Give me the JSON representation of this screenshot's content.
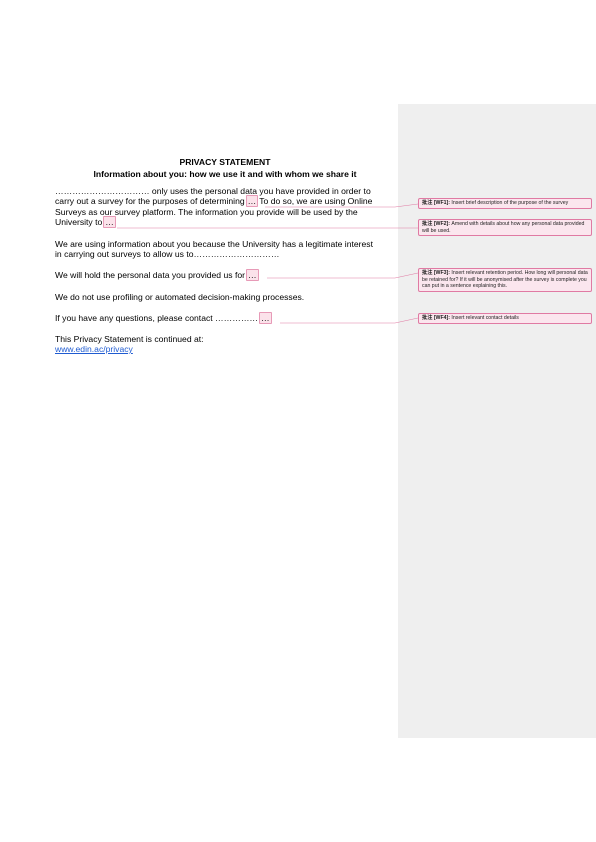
{
  "document": {
    "title": "PRIVACY STATEMENT",
    "subtitle": "Information about you: how we use it and with whom we share it",
    "p1_line1": "…………………………… only uses the personal data you have provided in order to",
    "p1_line2_a": "carry out a survey for the purposes of determining",
    "p1_line2_mark": "…",
    "p1_line2_b": "To do so, we are using Online",
    "p1_line3": "Surveys as our survey platform. The information you provide will be used by the",
    "p1_line4_a": "University to",
    "p1_line4_mark": "…",
    "p2_line1": "We are using information about you because the University has a legitimate interest",
    "p2_line2": "in carrying out surveys to allow us to…………………………",
    "p3_a": "We will hold the personal data you provided us for",
    "p3_mark": "…",
    "p4": "We do not use profiling or automated decision-making processes.",
    "p5_a": "If you have any questions, please contact ……………",
    "p5_mark": "…",
    "p6": "This Privacy Statement is continued at:",
    "link": "www.edin.ac/privacy"
  },
  "comments": [
    {
      "label": "批注 [WF1]:",
      "text": "Insert brief description of the purpose of the survey"
    },
    {
      "label": "批注 [WF2]:",
      "text": "Amend with details about how any personal data provided will be used."
    },
    {
      "label": "批注 [WF3]:",
      "text": "Insert relevant retention period. How long will personal data be retained for? If it will be anonymised after the survey is complete you can put in a sentence explaining this."
    },
    {
      "label": "批注 [WF4]:",
      "text": "Insert relevant contact details"
    }
  ],
  "colors": {
    "markup_pane": "#efefef",
    "comment_fill": "#fbe6ee",
    "comment_border": "#e07aa3",
    "link": "#1f5bd1"
  }
}
